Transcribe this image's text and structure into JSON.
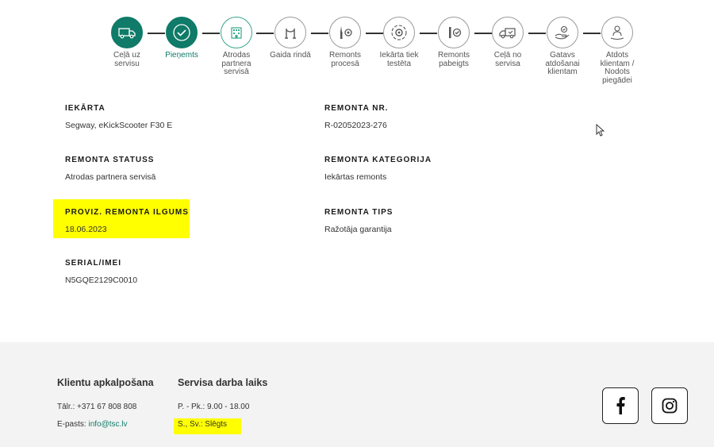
{
  "steps": [
    {
      "label": "Ceļā uz servisu",
      "state": "done",
      "icon": "van-icon"
    },
    {
      "label": "Pieņemts",
      "state": "done",
      "icon": "check-icon"
    },
    {
      "label": "Atrodas partnera servisā",
      "state": "current",
      "icon": "building-icon"
    },
    {
      "label": "Gaida rindā",
      "state": "pending",
      "icon": "queue-barrier-icon"
    },
    {
      "label": "Remonts procesā",
      "state": "pending",
      "icon": "tools-icon"
    },
    {
      "label": "Iekārta tiek testēta",
      "state": "pending",
      "icon": "gear-cycle-icon"
    },
    {
      "label": "Remonts pabeigts",
      "state": "pending",
      "icon": "tools-check-icon"
    },
    {
      "label": "Ceļā no servisa",
      "state": "pending",
      "icon": "truck-return-icon"
    },
    {
      "label": "Gatavs atdošanai klientam",
      "state": "pending",
      "icon": "hand-check-icon"
    },
    {
      "label": "Atdots klientam / Nodots piegādei",
      "state": "pending",
      "icon": "person-hand-icon"
    }
  ],
  "details": {
    "device_label": "IEKĀRTA",
    "device_value": "Segway, eKickScooter F30 E",
    "repair_nr_label": "REMONTA NR.",
    "repair_nr_value": "R-02052023-276",
    "status_label": "REMONTA STATUSS",
    "status_value": "Atrodas partnera servisā",
    "category_label": "REMONTA KATEGORIJA",
    "category_value": "Iekārtas remonts",
    "duration_label": "PROVIZ. REMONTA ILGUMS",
    "duration_value": "18.06.2023",
    "type_label": "REMONTA TIPS",
    "type_value": "Ražotāja garantija",
    "serial_label": "SERIAL/IMEI",
    "serial_value": "N5GQE2129C0010"
  },
  "footer": {
    "support_title": "Klientu apkalpošana",
    "phone": "Tālr.: +371 67 808 808",
    "email_prefix": "E-pasts: ",
    "email_link": "info@tsc.lv",
    "hours_title": "Servisa darba laiks",
    "weekdays": "P. - Pk.: 9.00 - 18.00",
    "weekend": "S., Sv.: Slēgts"
  },
  "colors": {
    "accent": "#0f7b68",
    "highlight": "#ffff00"
  }
}
